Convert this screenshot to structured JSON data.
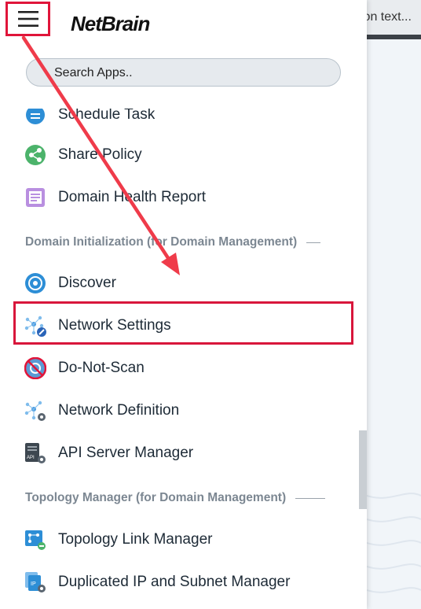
{
  "background": {
    "field_text": "ion text..."
  },
  "header": {
    "menu_icon": "hamburger-menu-icon",
    "logo_text": "NetBrain"
  },
  "search": {
    "placeholder": "Search Apps.."
  },
  "menu": {
    "partial_item": "Schedule Task",
    "items_top": [
      {
        "label": "Share Policy",
        "icon": "share-icon"
      },
      {
        "label": "Domain Health Report",
        "icon": "report-icon"
      }
    ],
    "section1": "Domain Initialization (for Domain Management)",
    "items_mid": [
      {
        "label": "Discover",
        "icon": "discover-icon"
      },
      {
        "label": "Network Settings",
        "icon": "network-settings-icon"
      },
      {
        "label": "Do-Not-Scan",
        "icon": "do-not-scan-icon"
      },
      {
        "label": "Network Definition",
        "icon": "network-definition-icon"
      },
      {
        "label": "API Server Manager",
        "icon": "api-server-icon"
      }
    ],
    "section2": "Topology Manager (for Domain Management)",
    "items_bottom": [
      {
        "label": "Topology Link Manager",
        "icon": "topology-link-icon"
      },
      {
        "label": "Duplicated IP and Subnet Manager",
        "icon": "duplicated-ip-icon"
      }
    ]
  },
  "colors": {
    "annotation_red": "#e0153a",
    "accent_blue": "#2d8ed6"
  }
}
